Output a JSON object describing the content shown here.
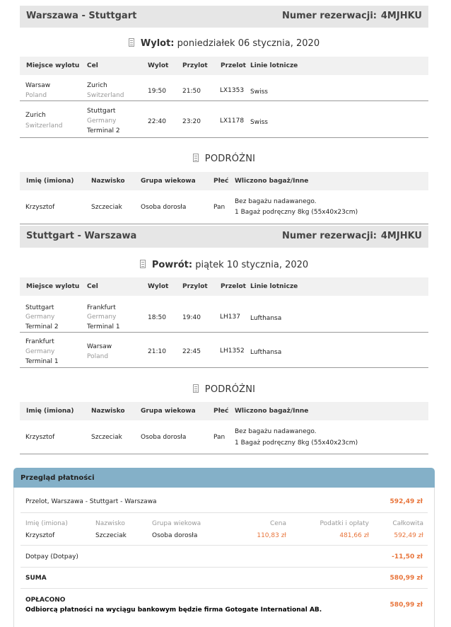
{
  "outbound": {
    "route": "Warszawa - Stuttgart",
    "booking_label": "Numer rezerwacji:",
    "booking_code": "4MJHKU",
    "direction_label": "Wylot:",
    "date": "poniedziałek 06 stycznia, 2020",
    "headers": [
      "Miejsce wylotu",
      "Cel",
      "Wylot",
      "Przylot",
      "Przelot",
      "Linie lotnicze"
    ],
    "flights": [
      {
        "from_city": "Warsaw",
        "from_country": "Poland",
        "from_terminal": "",
        "to_city": "Zurich",
        "to_country": "Switzerland",
        "to_terminal": "",
        "dep": "19:50",
        "arr": "21:50",
        "flight": "LX1353",
        "airline": "Swiss"
      },
      {
        "from_city": "Zurich",
        "from_country": "Switzerland",
        "from_terminal": "",
        "to_city": "Stuttgart",
        "to_country": "Germany",
        "to_terminal": "Terminal 2",
        "dep": "22:40",
        "arr": "23:20",
        "flight": "LX1178",
        "airline": "Swiss"
      }
    ],
    "travellers_title": "PODRÓŻNI",
    "traveller_headers": [
      "Imię (imiona)",
      "Nazwisko",
      "Grupa wiekowa",
      "Płeć",
      "Wliczono bagaż/Inne"
    ],
    "traveller": {
      "first": "Krzysztof",
      "last": "Szczeciak",
      "age_group": "Osoba dorosła",
      "gender": "Pan",
      "bag1": "Bez bagażu nadawanego.",
      "bag2": "1 Bagaż podręczny 8kg (55x40x23cm)"
    }
  },
  "return": {
    "route": "Stuttgart - Warszawa",
    "booking_label": "Numer rezerwacji:",
    "booking_code": "4MJHKU",
    "direction_label": "Powrót:",
    "date": "piątek 10 stycznia, 2020",
    "headers": [
      "Miejsce wylotu",
      "Cel",
      "Wylot",
      "Przylot",
      "Przelot",
      "Linie lotnicze"
    ],
    "flights": [
      {
        "from_city": "Stuttgart",
        "from_country": "Germany",
        "from_terminal": "Terminal 2",
        "to_city": "Frankfurt",
        "to_country": "Germany",
        "to_terminal": "Terminal 1",
        "dep": "18:50",
        "arr": "19:40",
        "flight": "LH137",
        "airline": "Lufthansa"
      },
      {
        "from_city": "Frankfurt",
        "from_country": "Germany",
        "from_terminal": "Terminal 1",
        "to_city": "Warsaw",
        "to_country": "Poland",
        "to_terminal": "",
        "dep": "21:10",
        "arr": "22:45",
        "flight": "LH1352",
        "airline": "Lufthansa"
      }
    ],
    "travellers_title": "PODRÓŻNI",
    "traveller_headers": [
      "Imię (imiona)",
      "Nazwisko",
      "Grupa wiekowa",
      "Płeć",
      "Wliczono bagaż/Inne"
    ],
    "traveller": {
      "first": "Krzysztof",
      "last": "Szczeciak",
      "age_group": "Osoba dorosła",
      "gender": "Pan",
      "bag1": "Bez bagażu nadawanego.",
      "bag2": "1 Bagaż podręczny 8kg (55x40x23cm)"
    }
  },
  "payment": {
    "title": "Przegląd płatności",
    "trip_label": "Przelot, Warszawa - Stuttgart - Warszawa",
    "trip_total": "592,49 zł",
    "headers": [
      "Imię (imiona)",
      "Nazwisko",
      "Grupa wiekowa",
      "Cena",
      "Podatki i opłaty",
      "Całkowita"
    ],
    "row": {
      "first": "Krzysztof",
      "last": "Szczeciak",
      "age_group": "Osoba dorosła",
      "price": "110,83 zł",
      "taxes": "481,66 zł",
      "total": "592,49 zł"
    },
    "dotpay_label": "Dotpay (Dotpay)",
    "dotpay_value": "-11,50 zł",
    "sum_label": "SUMA",
    "sum_value": "580,99 zł",
    "paid_label": "OPŁACONO",
    "paid_note": "Odbiorcą płatności na wyciągu bankowym będzie firma Gotogate International AB.",
    "paid_value": "580,99 zł"
  },
  "colors": {
    "payment_header": "#84b0c8",
    "price_accent": "#e8743a",
    "route_bar": "#e6e6e6",
    "table_header": "#f1f1f1"
  }
}
